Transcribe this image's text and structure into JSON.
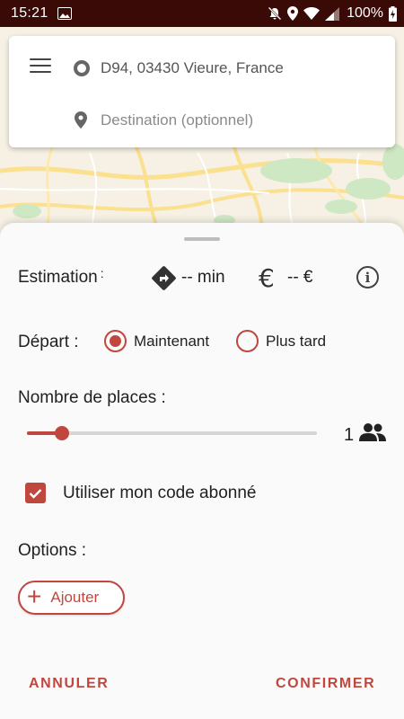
{
  "status_bar": {
    "time": "15:21",
    "battery": "100%",
    "icons": [
      "image-icon",
      "mute-icon",
      "location-icon",
      "wifi-icon",
      "signal-icon",
      "battery-charging-icon"
    ]
  },
  "search": {
    "origin": "D94, 03430 Vieure, France",
    "destination_placeholder": "Destination (optionnel)"
  },
  "estimation": {
    "label": "Estimation",
    "colon": ":",
    "duration": "-- min",
    "price": "-- €"
  },
  "depart": {
    "label": "Départ :",
    "options": [
      {
        "label": "Maintenant",
        "selected": true
      },
      {
        "label": "Plus tard",
        "selected": false
      }
    ]
  },
  "places": {
    "label": "Nombre de places :",
    "value": "1",
    "slider_fraction": 0.12
  },
  "subscriber": {
    "label": "Utiliser mon code abonné",
    "checked": true
  },
  "options": {
    "label": "Options :",
    "add_label": "Ajouter"
  },
  "actions": {
    "cancel": "ANNULER",
    "confirm": "CONFIRMER"
  },
  "colors": {
    "accent": "#c0473d",
    "status_bar": "#3a0a07"
  }
}
